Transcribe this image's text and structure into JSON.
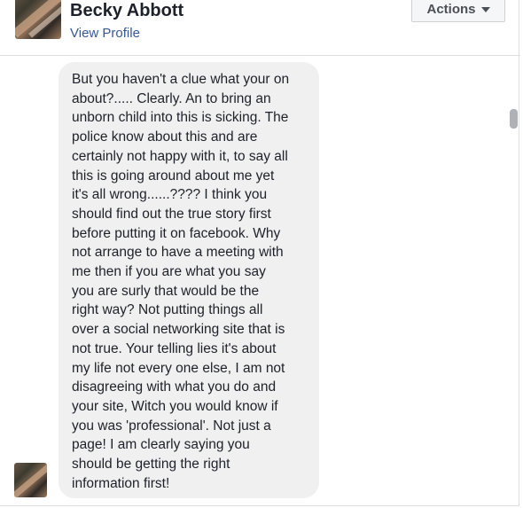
{
  "header": {
    "name": "Becky Abbott",
    "profile_link": "View Profile",
    "actions_label": "Actions"
  },
  "message": {
    "text": "But you haven't a clue what your on\nabout?..... Clearly. An to bring an\nunborn child into this is sicking. The\npolice know about this and are\ncertainly not happy with it, to say all\nthis is going around about me yet\nit's all wrong......???? I think you\nshould find out the true story first\nbefore putting it on facebook. Why\nnot arrange to have a meeting with\nme then if you are what you say\nyou are surly that would be the\nright way? Not putting things all\nover a social networking site that is\nnot true. Your telling lies it's about\nmy life not every one else, I am not\ndisagreeing with what you do and\nyour site, Witch you would know if\nyou was 'professional'. Not just a\npage! I am clearly saying you\nshould be getting the right\ninformation first!"
  },
  "icons": {
    "dropdown": "caret-down-icon",
    "scrollbar": "scrollbar-thumb"
  }
}
